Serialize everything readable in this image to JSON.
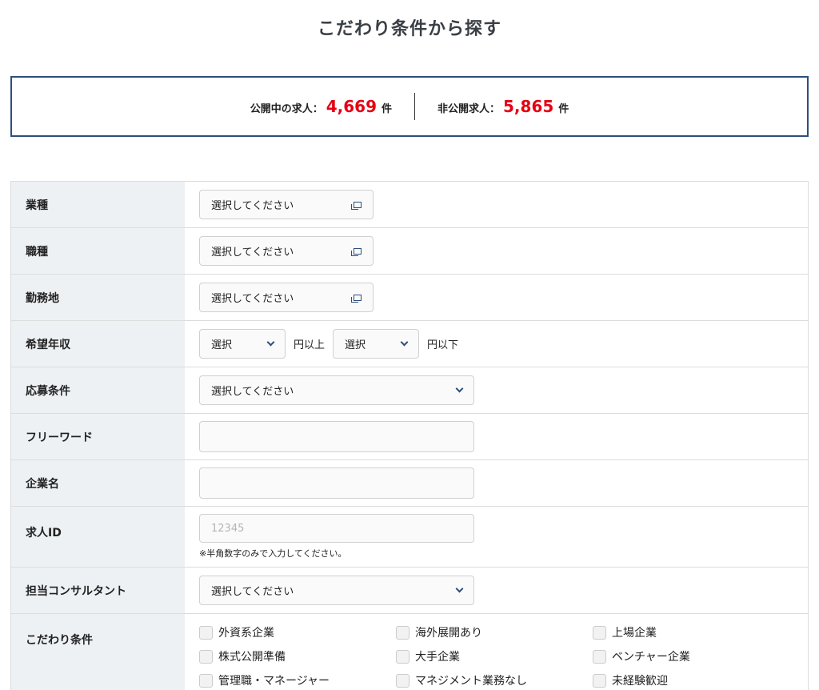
{
  "header": {
    "title": "こだわり条件から探す"
  },
  "summary": {
    "public_label": "公開中の求人：",
    "public_count": "4,669",
    "public_unit": "件",
    "private_label": "非公開求人：",
    "private_count": "5,865",
    "private_unit": "件"
  },
  "form": {
    "industry": {
      "label": "業種",
      "value": "選択してください"
    },
    "job_type": {
      "label": "職種",
      "value": "選択してください"
    },
    "location": {
      "label": "勤務地",
      "value": "選択してください"
    },
    "salary": {
      "label": "希望年収",
      "min_value": "選択",
      "min_unit": "円以上",
      "max_value": "選択",
      "max_unit": "円以下"
    },
    "application": {
      "label": "応募条件",
      "value": "選択してください"
    },
    "freeword": {
      "label": "フリーワード",
      "value": ""
    },
    "company": {
      "label": "企業名",
      "value": ""
    },
    "job_id": {
      "label": "求人ID",
      "placeholder": "12345",
      "note": "※半角数字のみで入力してください。"
    },
    "consultant": {
      "label": "担当コンサルタント",
      "value": "選択してください"
    },
    "preferences": {
      "label": "こだわり条件",
      "options": [
        "外資系企業",
        "海外展開あり",
        "上場企業",
        "株式公開準備",
        "大手企業",
        "ベンチャー企業",
        "管理職・マネージャー",
        "マネジメント業務なし",
        "未経験歓迎"
      ]
    }
  }
}
